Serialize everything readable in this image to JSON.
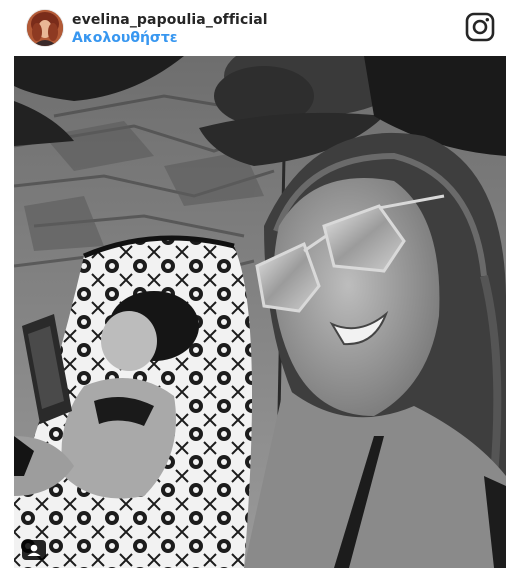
{
  "post": {
    "username": "evelina_papoulia_official",
    "follow_label": "Ακολουθήστε"
  },
  "icons": {
    "brand": "instagram-icon",
    "avatar": "avatar",
    "photo_tag": "user-tag-icon"
  },
  "colors": {
    "username": "#262626",
    "follow": "#3897f0",
    "background": "#ffffff"
  }
}
